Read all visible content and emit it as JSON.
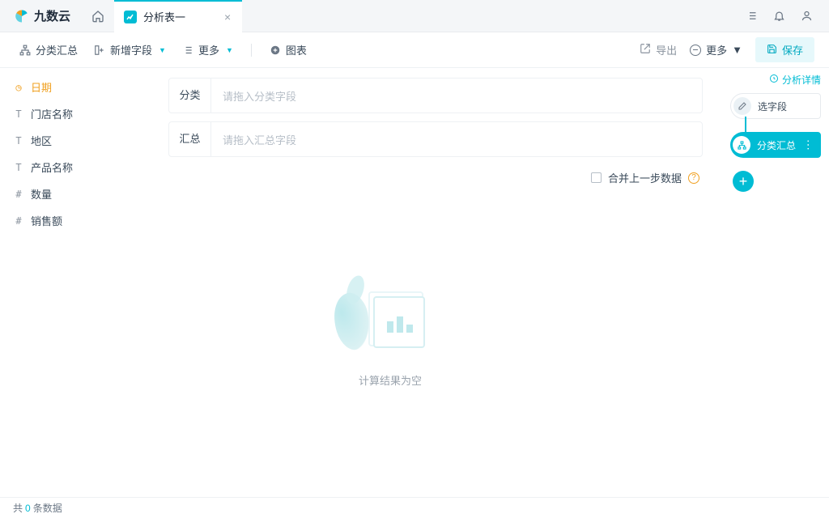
{
  "brand": "九数云",
  "tab": {
    "label": "分析表一"
  },
  "toolbar": {
    "cat_summary": "分类汇总",
    "add_field": "新增字段",
    "more": "更多",
    "chart": "图表",
    "export": "导出",
    "more_r": "更多",
    "save": "保存"
  },
  "fields": [
    {
      "icon": "date",
      "label": "日期",
      "active": true
    },
    {
      "icon": "text",
      "label": "门店名称"
    },
    {
      "icon": "text",
      "label": "地区"
    },
    {
      "icon": "text",
      "label": "产品名称"
    },
    {
      "icon": "num",
      "label": "数量"
    },
    {
      "icon": "num",
      "label": "销售额"
    }
  ],
  "drop": {
    "cat_label": "分类",
    "cat_ph": "请拖入分类字段",
    "sum_label": "汇总",
    "sum_ph": "请拖入汇总字段"
  },
  "merge_prev": "合并上一步数据",
  "empty_text": "计算结果为空",
  "right": {
    "detail": "分析详情",
    "step1": "选字段",
    "step2": "分类汇总"
  },
  "status": {
    "prefix": "共",
    "count": "0",
    "suffix": "条数据"
  }
}
